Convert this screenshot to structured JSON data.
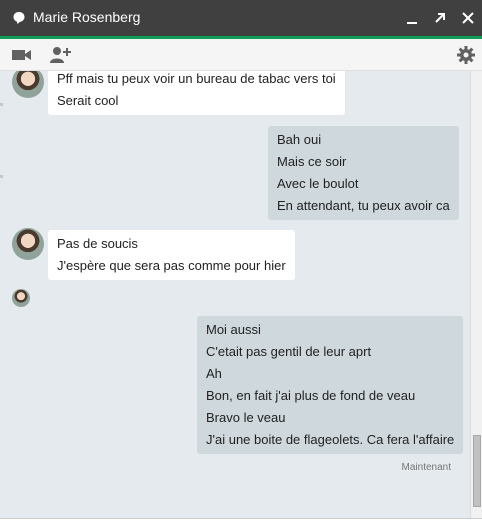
{
  "window": {
    "title": "Marie Rosenberg",
    "status_icon": "chat-bubble-icon",
    "controls": [
      "minimize-icon",
      "popout-icon",
      "close-icon"
    ],
    "accent_color": "#0f9d58",
    "titlebar_color": "#404040"
  },
  "toolbar": {
    "left_icons": [
      "video-call-icon",
      "add-person-icon"
    ],
    "right_icons": [
      "gear-icon"
    ]
  },
  "messages": [
    {
      "direction": "in",
      "lines": [
        "Pff mais tu peux voir un bureau de tabac vers toi",
        "Serait cool"
      ]
    },
    {
      "direction": "out",
      "lines": [
        "Bah oui",
        "Mais ce soir",
        "Avec le boulot",
        "En attendant, tu peux avoir ca"
      ]
    },
    {
      "direction": "in",
      "lines": [
        "Pas de soucis",
        "J'espère que sera pas comme pour hier"
      ]
    },
    {
      "direction": "out",
      "lines": [
        "Moi aussi",
        "C'etait pas gentil de leur aprt",
        "Ah",
        "Bon, en fait j'ai plus de fond de veau",
        "Bravo le veau",
        "J'ai une boite de flageolets. Ca fera l'affaire"
      ]
    }
  ],
  "timestamp": "Maintenant"
}
